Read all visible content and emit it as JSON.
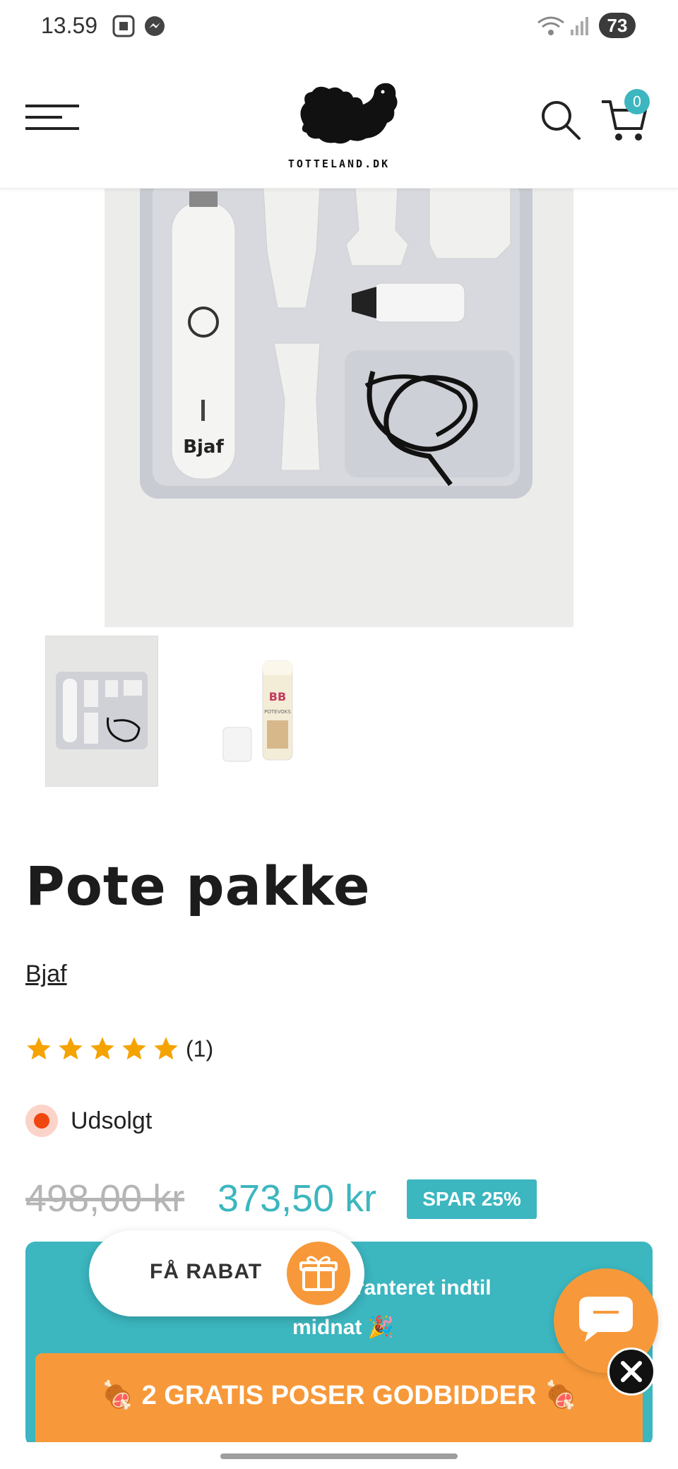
{
  "status_bar": {
    "time": "13.59",
    "battery": "73",
    "icons": [
      "screenshot-icon",
      "messenger-icon",
      "wifi-icon",
      "signal-icon"
    ]
  },
  "header": {
    "logo_text": "TOTTELAND.DK",
    "cart_count": "0",
    "icons": [
      "menu-icon",
      "search-icon",
      "cart-icon"
    ]
  },
  "gallery": {
    "main_image_brand_text": "Bjaf",
    "thumb_labels": [
      "BB",
      "POTEVOKS"
    ]
  },
  "product": {
    "title": "Pote pakke",
    "brand": "Bjaf",
    "rating": 5,
    "rating_count": "(1)",
    "stock_status": "Udsolgt",
    "price_old": "498,00 kr",
    "price_new": "373,50 kr",
    "save_badge": "SPAR 25%"
  },
  "promo": {
    "text_line1": "🎉 … riserne garanteret indtil",
    "text_line2": "midnat 🎉",
    "bar_text": "🍖 2 GRATIS POSER GODBIDDER 🍖"
  },
  "discount_widget": {
    "label": "FÅ RABAT"
  },
  "colors": {
    "accent": "#3cb6bf",
    "orange": "#f7993a",
    "stock_dot": "#f0460f",
    "star": "#f5a300"
  }
}
